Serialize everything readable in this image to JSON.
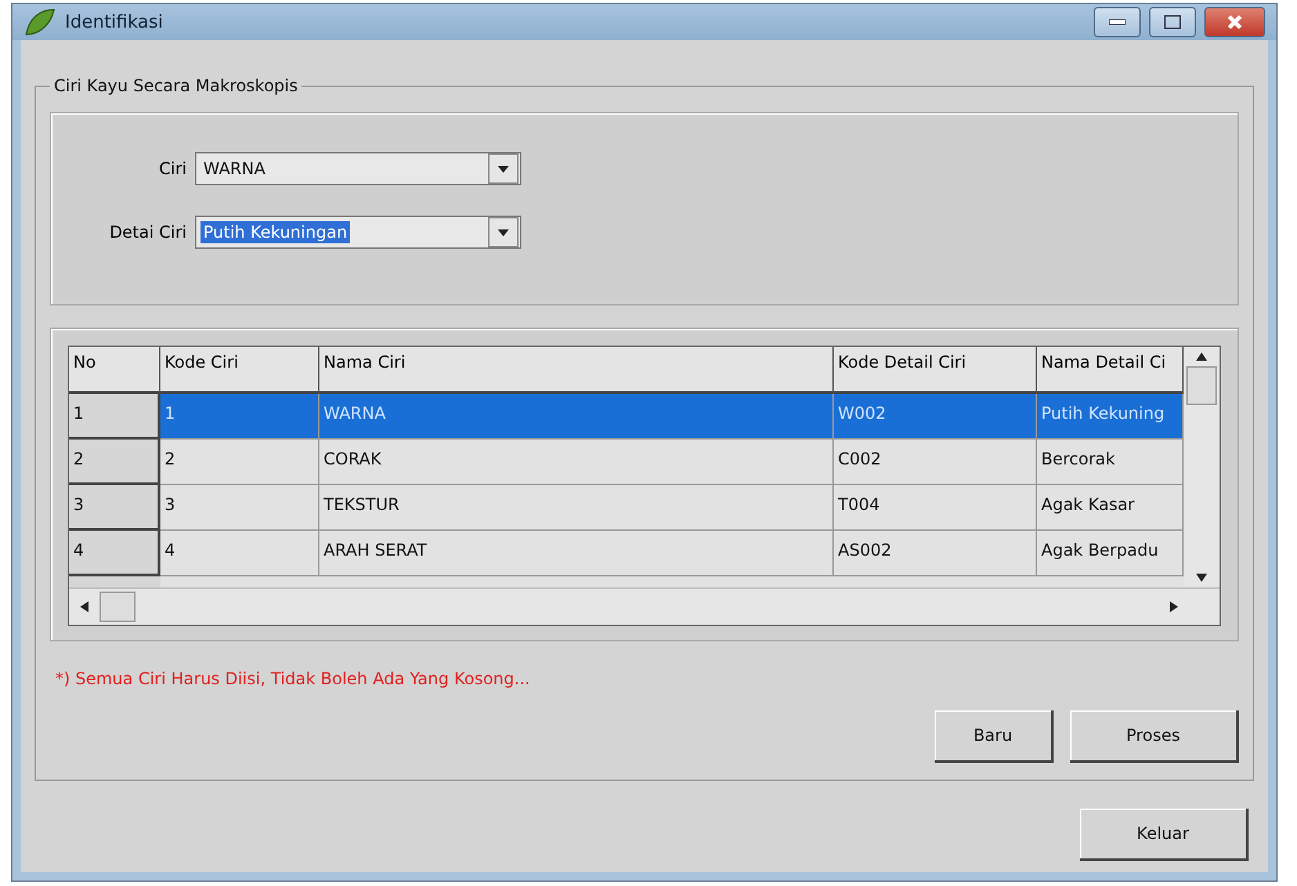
{
  "window": {
    "title": "Identifikasi"
  },
  "group": {
    "title": "Ciri Kayu Secara Makroskopis"
  },
  "fields": [
    {
      "label": "Ciri",
      "value": "WARNA",
      "text_selected": false
    },
    {
      "label": "Detai Ciri",
      "value": "Putih Kekuningan",
      "text_selected": true
    }
  ],
  "table": {
    "columns": [
      "No",
      "Kode Ciri",
      "Nama Ciri",
      "Kode Detail Ciri",
      "Nama Detail Ci"
    ],
    "rows": [
      {
        "cells": [
          "1",
          "1",
          "WARNA",
          "W002",
          "Putih Kekuning"
        ],
        "selected": true
      },
      {
        "cells": [
          "2",
          "2",
          "CORAK",
          "C002",
          "Bercorak"
        ],
        "selected": false
      },
      {
        "cells": [
          "3",
          "3",
          "TEKSTUR",
          "T004",
          "Agak Kasar"
        ],
        "selected": false
      },
      {
        "cells": [
          "4",
          "4",
          "ARAH SERAT",
          "AS002",
          "Agak Berpadu"
        ],
        "selected": false
      }
    ]
  },
  "note": "*) Semua Ciri Harus Diisi, Tidak Boleh Ada Yang Kosong...",
  "buttons": [
    "Baru",
    "Proses"
  ],
  "exit_button": "Keluar"
}
